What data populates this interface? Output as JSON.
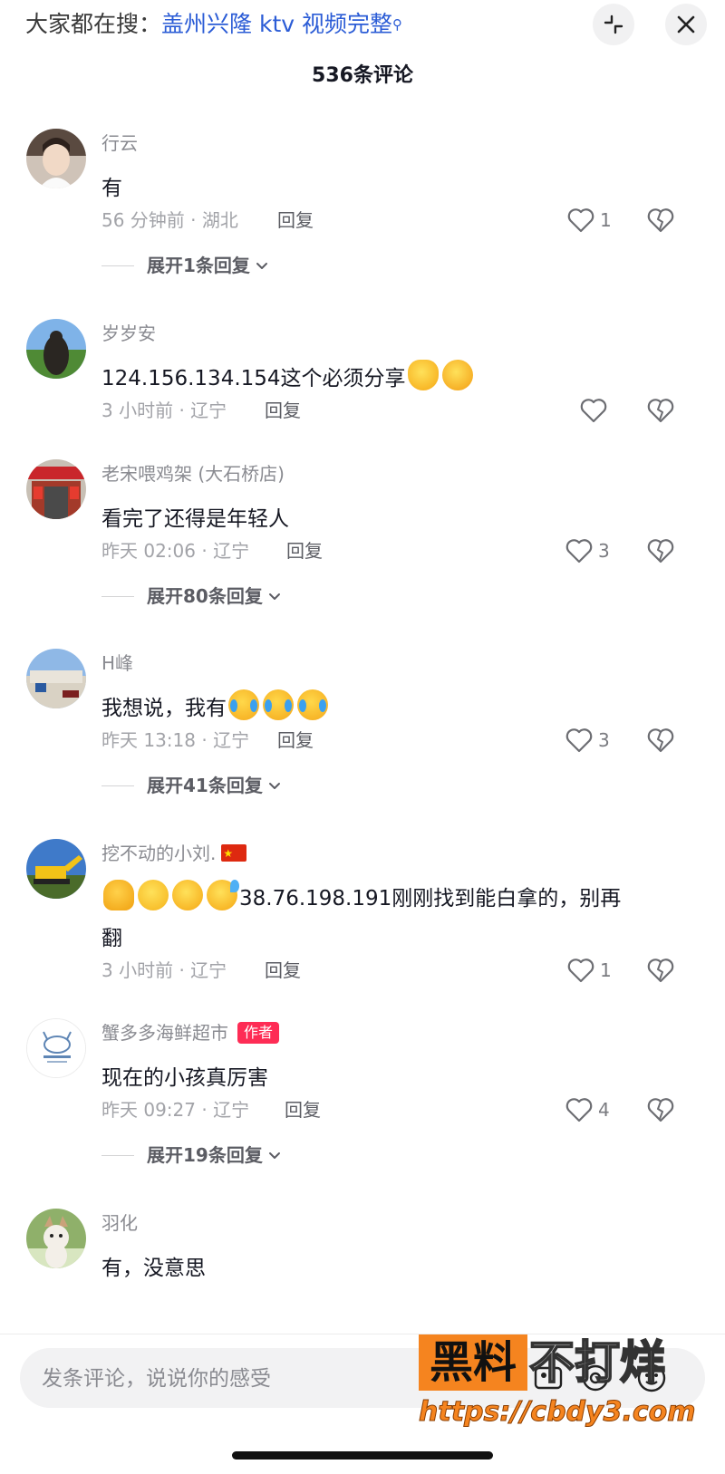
{
  "search_bar": {
    "prefix": "大家都在搜：",
    "query": "盖州兴隆 ktv 视频完整"
  },
  "header": {
    "comment_count": "536条评论"
  },
  "comments": [
    {
      "username": "行云",
      "text": "有",
      "emojis": [],
      "meta": "56 分钟前 · 湖北",
      "reply_label": "回复",
      "like_count": "1",
      "expand_label": "展开1条回复"
    },
    {
      "username": "岁岁安",
      "text": "124.156.134.154这个必须分享",
      "emojis": [
        "clap-emoji",
        "angry-emoji"
      ],
      "meta": "3 小时前 · 辽宁",
      "reply_label": "回复",
      "like_count": ""
    },
    {
      "username": "老宋喂鸡架 (大石桥店)",
      "text": "看完了还得是年轻人",
      "emojis": [],
      "meta": "昨天 02:06 · 辽宁",
      "reply_label": "回复",
      "like_count": "3",
      "expand_label": "展开80条回复"
    },
    {
      "username": "H峰",
      "text": "我想说，我有",
      "emojis": [
        "crying-face-emoji",
        "crying-face-emoji",
        "crying-face-emoji"
      ],
      "meta": "昨天 13:18 · 辽宁",
      "reply_label": "回复",
      "like_count": "3",
      "expand_label": "展开41条回复"
    },
    {
      "username": "挖不动的小刘.",
      "flag": "china-flag-icon",
      "text_line1": "38.76.198.191刚刚找到能白拿的，别再",
      "text_line2": "翻",
      "emojis": [
        "pray-emoji",
        "thinking-emoji",
        "laughing-emoji",
        "sweat-emoji"
      ],
      "meta": "3 小时前 · 辽宁",
      "reply_label": "回复",
      "like_count": "1"
    },
    {
      "username": "蟹多多海鲜超市",
      "badge": "作者",
      "text": "现在的小孩真厉害",
      "emojis": [],
      "meta": "昨天 09:27 · 辽宁",
      "reply_label": "回复",
      "like_count": "4",
      "expand_label": "展开19条回复"
    },
    {
      "username": "羽化",
      "text": "有，没意思",
      "emojis": []
    }
  ],
  "composer": {
    "placeholder": "发条评论，说说你的感受"
  },
  "watermark": {
    "highlight": "黑料",
    "rest": "不打烊",
    "url": "https://cbdy3.com"
  },
  "colors": {
    "accent": "#fe2c55",
    "link": "#2b5cd6",
    "muted": "#8a8b91",
    "watermark_orange": "#f5841f"
  }
}
